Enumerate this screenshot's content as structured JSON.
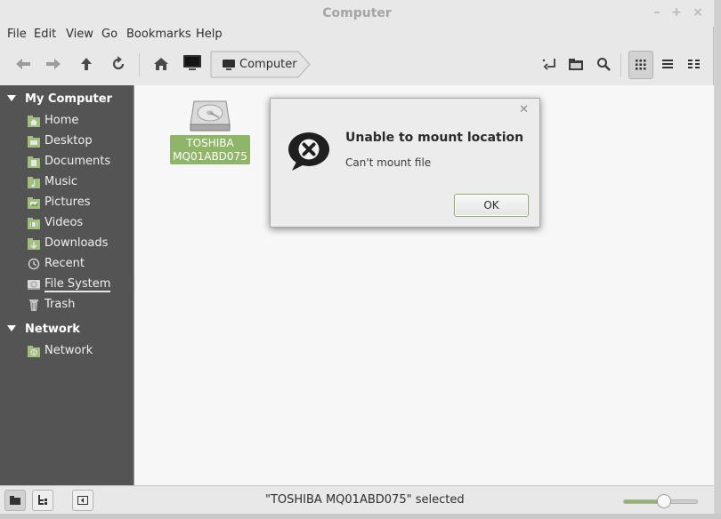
{
  "window": {
    "title": "Computer"
  },
  "menu": [
    "File",
    "Edit",
    "View",
    "Go",
    "Bookmarks",
    "Help"
  ],
  "toolbar": {
    "back_icon": "back-arrow-icon",
    "forward_icon": "forward-arrow-icon",
    "up_icon": "up-arrow-icon",
    "reload_icon": "reload-icon",
    "home_icon": "home-icon",
    "computer_icon": "computer-icon",
    "path_label": "Computer"
  },
  "sidebar": {
    "sections": [
      {
        "title": "My Computer",
        "items": [
          {
            "label": "Home",
            "icon": "home-folder-icon"
          },
          {
            "label": "Desktop",
            "icon": "desktop-folder-icon"
          },
          {
            "label": "Documents",
            "icon": "documents-folder-icon"
          },
          {
            "label": "Music",
            "icon": "music-folder-icon"
          },
          {
            "label": "Pictures",
            "icon": "pictures-folder-icon"
          },
          {
            "label": "Videos",
            "icon": "videos-folder-icon"
          },
          {
            "label": "Downloads",
            "icon": "downloads-folder-icon"
          },
          {
            "label": "Recent",
            "icon": "recent-icon"
          },
          {
            "label": "File System",
            "icon": "drive-icon"
          },
          {
            "label": "Trash",
            "icon": "trash-icon"
          }
        ]
      },
      {
        "title": "Network",
        "items": [
          {
            "label": "Network",
            "icon": "network-folder-icon"
          }
        ]
      }
    ]
  },
  "content": {
    "items": [
      {
        "name_line1": "TOSHIBA",
        "name_line2": "MQ01ABD075",
        "icon": "hard-drive-icon",
        "selected": true
      }
    ]
  },
  "dialog": {
    "title": "Unable to mount location",
    "message": "Can't mount file",
    "ok_label": "OK",
    "icon": "error-icon"
  },
  "statusbar": {
    "text": "\"TOSHIBA MQ01ABD075\" selected",
    "zoom_level": 0.55
  },
  "colors": {
    "accent": "#8fb569",
    "sidebar_bg": "#545454"
  }
}
